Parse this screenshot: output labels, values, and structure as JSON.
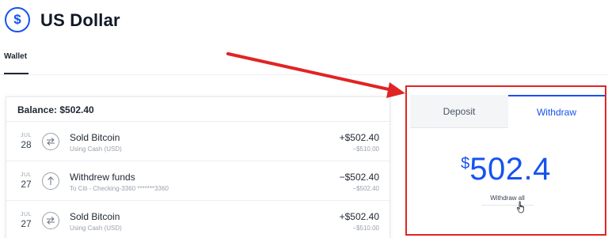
{
  "header": {
    "currency_symbol": "$",
    "title": "US Dollar"
  },
  "tabs": {
    "wallet_label": "Wallet"
  },
  "wallet": {
    "balance_label": "Balance: $502.40",
    "transactions": [
      {
        "month": "JUL",
        "day": "28",
        "icon": "swap-icon",
        "title": "Sold Bitcoin",
        "subtitle": "Using Cash (USD)",
        "amount": "+$502.40",
        "sub_amount": "−$510.00"
      },
      {
        "month": "JUL",
        "day": "27",
        "icon": "upload-arrow-icon",
        "title": "Withdrew funds",
        "subtitle": "To Citi - Checking-3360 *******3360",
        "amount": "−$502.40",
        "sub_amount": "−$502.40"
      },
      {
        "month": "JUL",
        "day": "27",
        "icon": "swap-icon",
        "title": "Sold Bitcoin",
        "subtitle": "Using Cash (USD)",
        "amount": "+$502.40",
        "sub_amount": "−$510.00"
      }
    ]
  },
  "panel": {
    "deposit_tab": "Deposit",
    "withdraw_tab": "Withdraw",
    "currency_symbol": "$",
    "amount": "502.4",
    "withdraw_all_label": "Withdraw all"
  },
  "colors": {
    "accent": "#1652f0",
    "highlight": "#e02424"
  }
}
